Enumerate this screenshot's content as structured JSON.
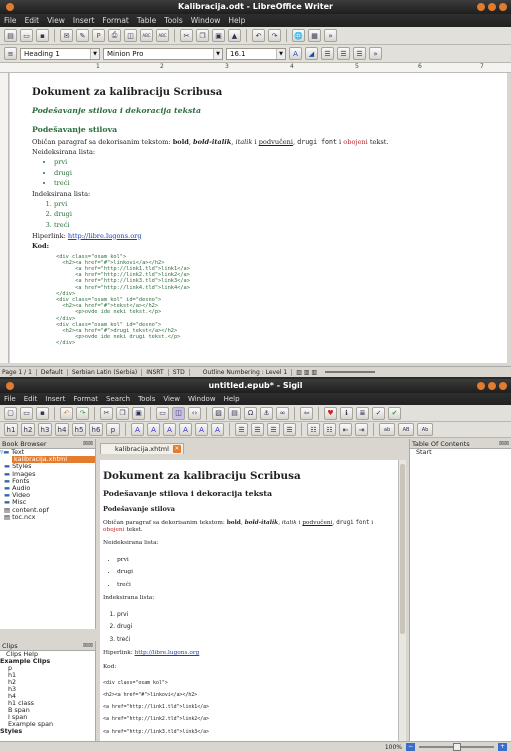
{
  "lo": {
    "title": "Kalibracija.odt - LibreOffice Writer",
    "menu": [
      "File",
      "Edit",
      "View",
      "Insert",
      "Format",
      "Table",
      "Tools",
      "Window",
      "Help"
    ],
    "style": "Heading 1",
    "font": "Minion Pro",
    "size": "16.1",
    "ruler": [
      "1",
      "2",
      "3",
      "4",
      "5",
      "6",
      "7"
    ],
    "doc": {
      "h1": "Dokument za kalibraciju Scribusa",
      "h2": "Podešavanje stilova i dekoracija teksta",
      "h3": "Podešavanje stilova",
      "p1a": "Običan paragraf sa dekorisanim tekstom: ",
      "bold": "bold",
      "bi": "bold-italik",
      "it": "italik",
      "und": "podvučeni",
      "mono": "drugi font",
      "col": "obojeni",
      "tekst": "tekst.",
      "comma1": ", ",
      "comma2": ", ",
      "i": " i ",
      "comma3": ", ",
      "i2": " i ",
      "ul_label": "Neideksirana lista:",
      "ul": [
        "prvi",
        "drugi",
        "treći"
      ],
      "ol_label": "Indeksirana lista:",
      "ol": [
        "prvi",
        "drugi",
        "treći"
      ],
      "link_label": "Hiperlink: ",
      "link": "http://libre.lugons.org",
      "code_label": "Kod:",
      "code": "<div class=\"osam kol\">\n  <h2><a href=\"#\">linkovi</a></h2>\n      <a href=\"http://link1.tld\">link1</a>\n      <a href=\"http://link2.tld\">link2</a>\n      <a href=\"http://link3.tld\">link3</a>\n      <a href=\"http://link4.tld\">link4</a>\n</div>\n<div class=\"osam kol\" id=\"desno\">\n  <h2><a href=\"#\">tekst</a></h2>\n      <p>ovde ide neki tekst.</p>\n</div>\n<div class=\"osam kol\" id=\"desno\">\n  <h2><a href=\"#\">drugi tekst</a></h2>\n      <p>ovde ide neki drugi tekst.</p>\n</div>"
    },
    "status": [
      "Page 1 / 1",
      "Default",
      "Serbian Latin (Serbia)",
      "INSRT",
      "STD",
      "",
      "Outline Numbering : Level 1"
    ]
  },
  "sigil": {
    "title": "untitled.epub* - Sigil",
    "menu": [
      "File",
      "Edit",
      "Insert",
      "Format",
      "Search",
      "Tools",
      "View",
      "Window",
      "Help"
    ],
    "hbtns": [
      "h1",
      "h2",
      "h3",
      "h4",
      "h5",
      "h6",
      "p"
    ],
    "rbtns": [
      "ab",
      "AB",
      "Ab"
    ],
    "browser_title": "Book Browser",
    "tree": [
      "Text",
      "kalibracija.xhtml",
      "Styles",
      "Images",
      "Fonts",
      "Audio",
      "Video",
      "Misc",
      "content.opf",
      "toc.ncx"
    ],
    "tab": "kalibracija.xhtml",
    "toc_title": "Table Of Contents",
    "toc": [
      "Start"
    ],
    "clips_title": "Clips",
    "clips": [
      "Clips Help",
      "Example Clips",
      "p",
      "h1",
      "h2",
      "h3",
      "h4",
      "h1 class",
      "B span",
      "I span",
      "Example span",
      "Styles"
    ],
    "zoom": "100%",
    "doc": {
      "h1": "Dokument za kalibraciju Scribusa",
      "h2": "Podešavanje stilova i dekoracija teksta",
      "h3": "Podešavanje stilova",
      "p1a": "Običan paragraf sa dekorisanim tekstom: ",
      "bold": "bold",
      "bi": "bold-italik",
      "it": "italik",
      "und": "podvučeni",
      "mono": "drugi",
      "mono2": "font",
      "col": "obojeni",
      "tekst": " tekst.",
      "ul_label": "Neideksirana lista:",
      "ul": [
        "prvi",
        "drugi",
        "treći"
      ],
      "ol_label": "Indeksirana lista:",
      "ol": [
        "prvi",
        "drugi",
        "treći"
      ],
      "link_label": "Hiperlink: ",
      "link": "http://libre.lugons.org",
      "code_label": "Kod:",
      "code": "<div class=\"osam kol\">\n<h2><a href=\"#\">linkovi</a></h2>\n<a href=\"http://link1.tld\">link1</a>\n<a href=\"http://link2.tld\">link2</a>\n<a href=\"http://link3.tld\">link3</a>"
    }
  }
}
